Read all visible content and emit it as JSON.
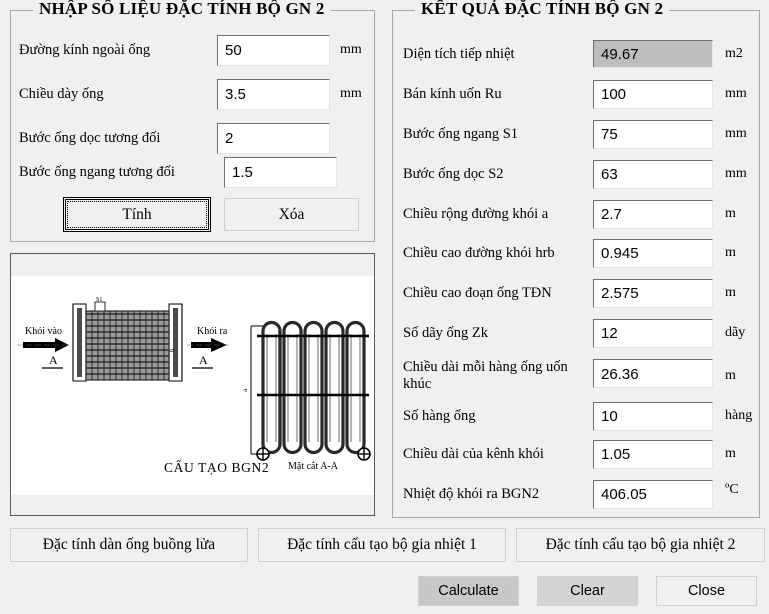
{
  "input_group": {
    "legend": "NHẬP SỐ LIỆU ĐẶC TÍNH BỘ GN 2",
    "rows": [
      {
        "label": "Đường kính ngoài ống",
        "value": "50",
        "unit": "mm"
      },
      {
        "label": "Chiều dày ống",
        "value": "3.5",
        "unit": "mm"
      },
      {
        "label": "Bước ống dọc tương đối",
        "value": "2",
        "unit": ""
      },
      {
        "label": "Bước ống ngang tương đối",
        "value": "1.5",
        "unit": ""
      }
    ],
    "calc_button": "Tính",
    "clear_button": "Xóa"
  },
  "result_group": {
    "legend": "KẾT QUẢ ĐẶC TÍNH BỘ GN 2",
    "rows": [
      {
        "label": "Diện tích tiếp nhiệt",
        "value": "49.67",
        "unit": "m2",
        "readonly": true
      },
      {
        "label": "Bán kính uốn Ru",
        "value": "100",
        "unit": "mm",
        "readonly": false
      },
      {
        "label": "Bước ống ngang S1",
        "value": "75",
        "unit": "mm",
        "readonly": false
      },
      {
        "label": "Bước ống dọc S2",
        "value": "63",
        "unit": "mm",
        "readonly": false
      },
      {
        "label": "Chiều rộng đường khói a",
        "value": "2.7",
        "unit": "m",
        "readonly": false
      },
      {
        "label": "Chiều cao đường khói hrb",
        "value": "0.945",
        "unit": "m",
        "readonly": false
      },
      {
        "label": "Chiều cao đoạn ống TĐN",
        "value": "2.575",
        "unit": "m",
        "readonly": false
      },
      {
        "label": "Số dãy ống Zk",
        "value": "12",
        "unit": "dãy",
        "readonly": false
      },
      {
        "label": "Chiều dài mỗi hàng ống uốn khúc",
        "value": "26.36",
        "unit": "m",
        "readonly": false
      },
      {
        "label": "Số hàng ống",
        "value": "10",
        "unit": "hàng",
        "readonly": false
      },
      {
        "label": "Chiều dài của kênh khói",
        "value": "1.05",
        "unit": "m",
        "readonly": false
      },
      {
        "label": "Nhiệt độ khói ra BGN2",
        "value": "406.05",
        "unit": "ºC",
        "readonly": false
      }
    ]
  },
  "diagram": {
    "label_inlet": "Khói vào",
    "label_outlet": "Khói ra",
    "label_section_left": "A",
    "label_section_right": "A",
    "label_s1": "S1",
    "label_h": "h",
    "label_a": "a",
    "title": "CẤU TẠO BGN2",
    "section_title": "Mặt cắt A-A"
  },
  "tabs": [
    {
      "label": "Đặc tính dàn ống buồng lửa"
    },
    {
      "label": "Đặc tính cấu tạo bộ gia nhiệt 1"
    },
    {
      "label": "Đặc tính cấu tạo bộ gia nhiệt 2"
    }
  ],
  "actions": [
    {
      "label": "Calculate"
    },
    {
      "label": "Clear"
    },
    {
      "label": "Close"
    }
  ],
  "colors": {
    "window_bg": "#f0f0f0",
    "field_bg": "#ffffff",
    "readonly_field_bg": "#bdbdbd",
    "group_border": "#a8a8a8",
    "text": "#000000",
    "calculate_bg": "#c8c8c8"
  }
}
